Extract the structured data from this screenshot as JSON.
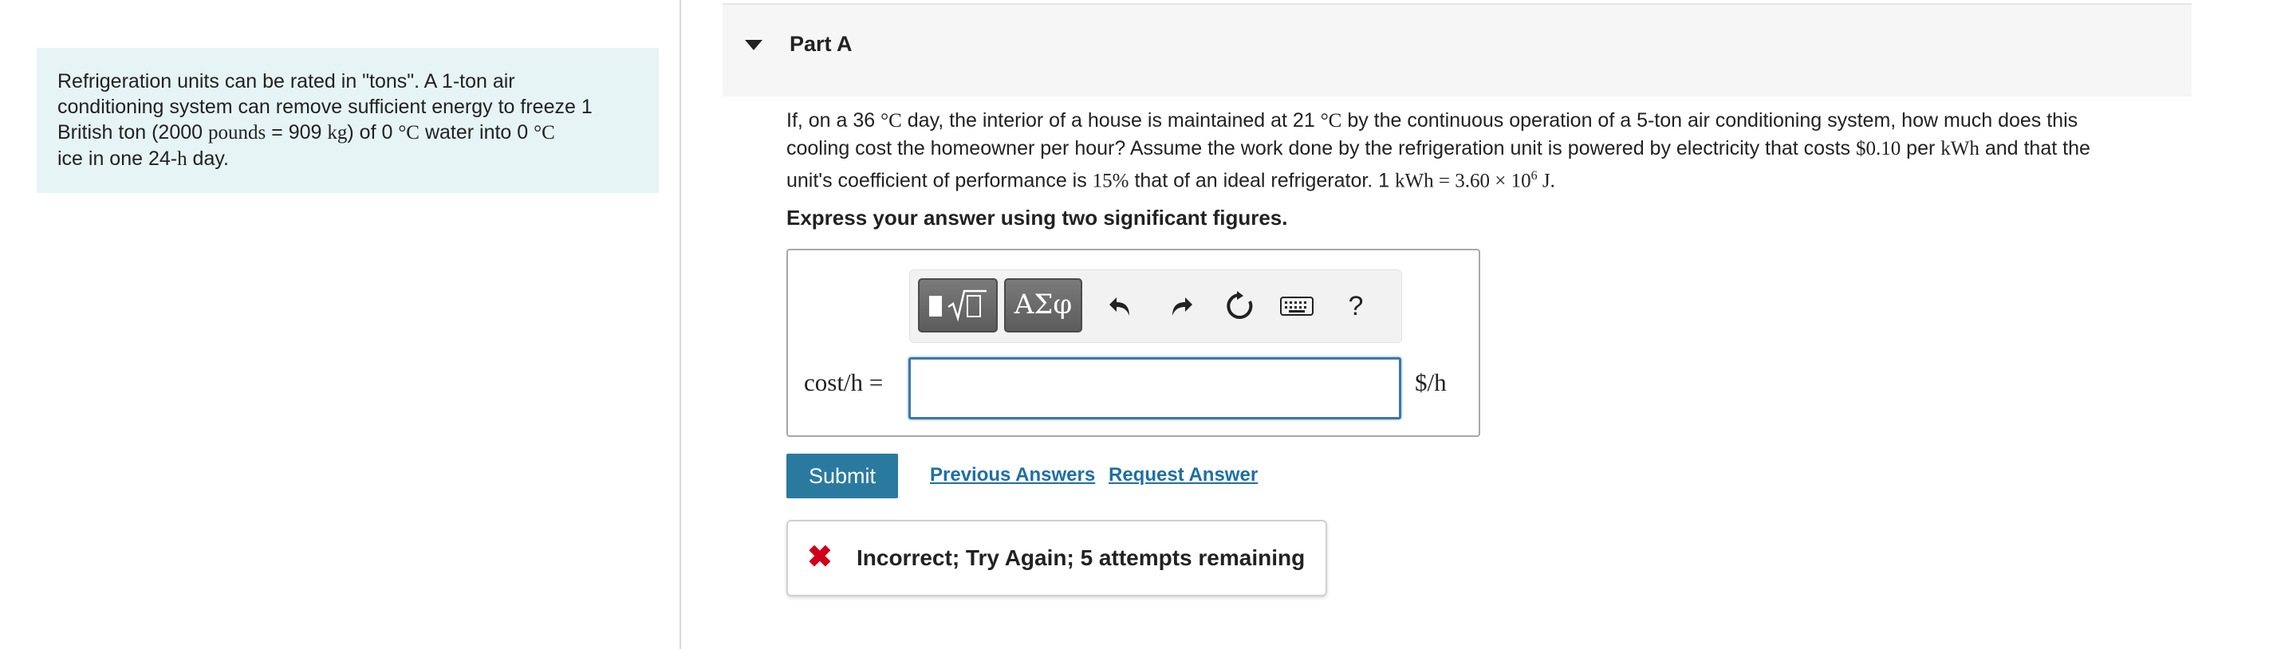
{
  "intro": {
    "line1": "Refrigeration units can be rated in \"tons\". A 1-ton air",
    "line2": "conditioning system can remove sufficient energy to freeze 1",
    "line3a": "British ton (2000 ",
    "line3_pounds": "pounds",
    "line3b": " = 909 ",
    "line3_kg": "kg",
    "line3c": ") of 0 ",
    "line3_degC": "°C",
    "line3d": " water into 0 ",
    "line3_degC2": "°C",
    "line4a": "ice in one 24-",
    "line4_h": "h",
    "line4b": " day."
  },
  "part": {
    "title": "Part A"
  },
  "question": {
    "l1a": "If, on a 36 ",
    "l1_degC": "°C",
    "l1b": " day, the interior of a house is maintained at 21 ",
    "l1_degC2": "°C",
    "l1c": " by the continuous operation of a 5-ton air conditioning system, how much does this",
    "l2a": "cooling cost the homeowner per hour? Assume the work done by the refrigeration unit is powered by electricity that costs ",
    "l2_price": "$0.10",
    "l2b": " per ",
    "l2_kwh": "kWh",
    "l2c": " and that the",
    "l3a": "unit's coefficient of performance is ",
    "l3_pct": "15%",
    "l3b": " that of an ideal refrigerator. 1 ",
    "l3_kwh": "kWh",
    "l3c": " = 3.60 × 10",
    "l3_exp": "6",
    "l3_j": " J."
  },
  "instruction": "Express your answer using two significant figures.",
  "toolbar": {
    "greek_label": "ΑΣφ",
    "help_label": "?",
    "icons": [
      "templates-icon",
      "greek-letters-icon",
      "undo-icon",
      "redo-icon",
      "reset-icon",
      "keyboard-icon",
      "help-icon"
    ]
  },
  "answer": {
    "lhs": "cost/h =",
    "value": "",
    "unit": "$/h"
  },
  "actions": {
    "submit_label": "Submit",
    "previous_answers": "Previous Answers",
    "request_answer": "Request Answer"
  },
  "feedback": {
    "message": "Incorrect; Try Again; 5 attempts remaining"
  },
  "colors": {
    "accent": "#2a7aa0",
    "link": "#1f6fa3",
    "error": "#d0021b",
    "intro_bg": "#e6f4f5"
  }
}
